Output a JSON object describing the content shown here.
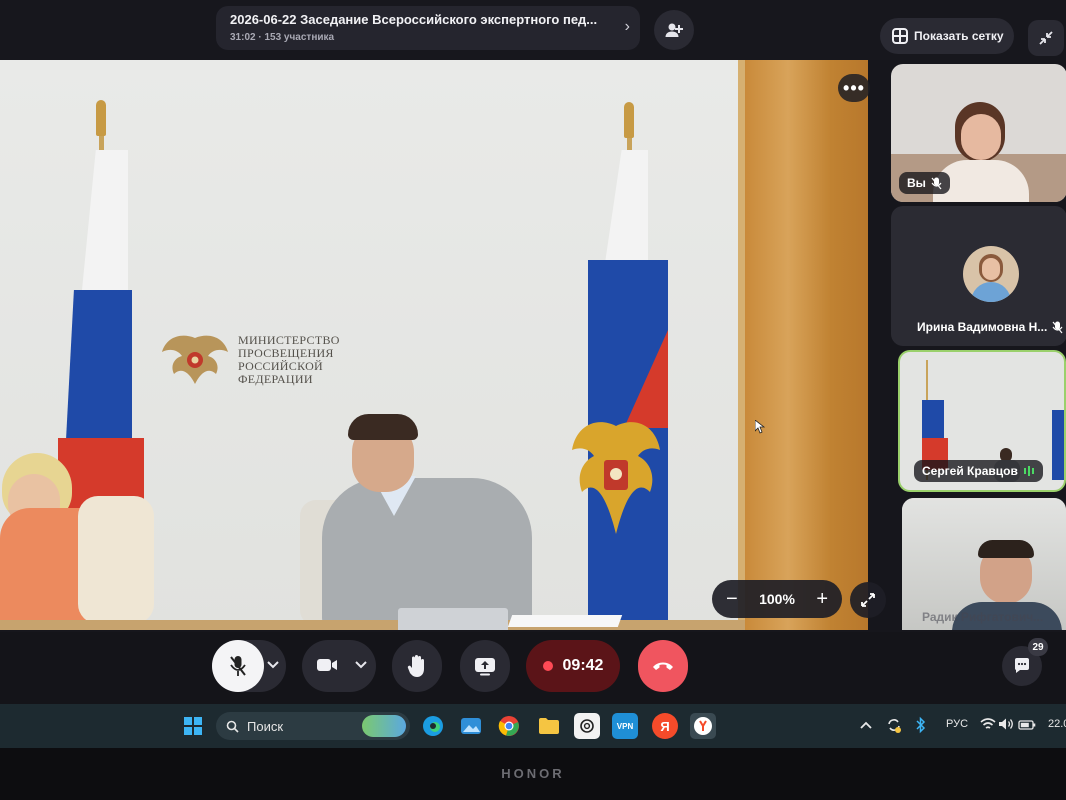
{
  "meeting": {
    "title": "2026-06-22 Заседание Всероссийского экспертного пед...",
    "subtitle": "31:02 · 153 участника"
  },
  "header": {
    "grid_button_label": "Показать сетку"
  },
  "main_video": {
    "ministry_lines": [
      "МИНИСТЕРСТВО",
      "ПРОСВЕЩЕНИЯ",
      "РОССИЙСКОЙ",
      "ФЕДЕРАЦИИ"
    ],
    "zoom_level": "100%",
    "zoom_minus": "−",
    "zoom_plus": "+",
    "more_glyph": "•••"
  },
  "participants": [
    {
      "name": "Вы"
    },
    {
      "name": "Ирина Вадимовна Н..."
    },
    {
      "name": "Сергей Кравцов"
    },
    {
      "name": "Радик Рифгатович..."
    }
  ],
  "controls": {
    "record_time": "09:42",
    "chat_count": "29"
  },
  "taskbar": {
    "search_label": "Поиск",
    "yandex_letter": "Я",
    "language": "РУС",
    "clock": "22.0"
  },
  "monitor": {
    "brand": "HONOR"
  },
  "colors": {
    "accent_red": "#f0555f",
    "record_bg": "#5b1418",
    "speaking_green": "#4cd964"
  }
}
